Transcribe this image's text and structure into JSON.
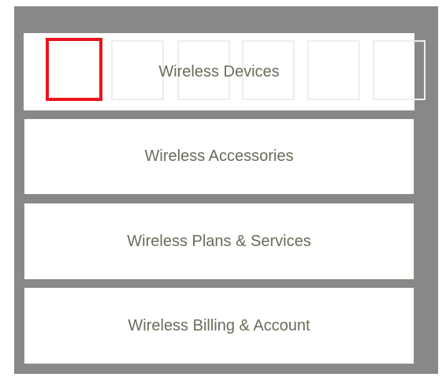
{
  "menu": {
    "items": [
      {
        "label": "Wireless Devices"
      },
      {
        "label": "Wireless Accessories"
      },
      {
        "label": "Wireless Plans & Services"
      },
      {
        "label": "Wireless Billing & Account"
      }
    ]
  },
  "carousel": {
    "thumb_count": 6,
    "selected_index": 0,
    "selected_color": "#e8141c"
  },
  "colors": {
    "frame": "#888888",
    "text": "#6b6b5b"
  }
}
